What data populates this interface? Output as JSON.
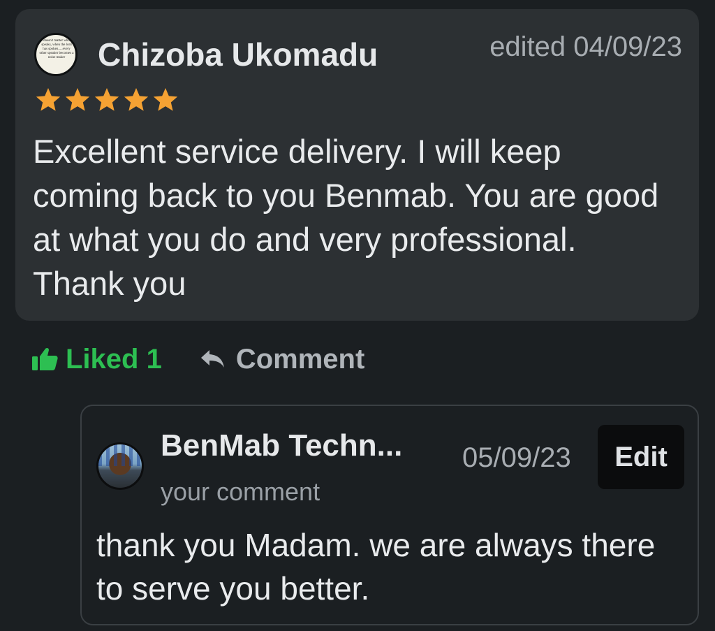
{
  "review": {
    "reviewer_name": "Chizoba Ukomadu",
    "date": "edited 04/09/23",
    "rating": 5,
    "rating_max": 5,
    "star_color": "#f5a233",
    "avatar_text": "doesn't matter who speaks, when the lord has spoken.....every other speaker becomes a noise maker",
    "text": "Excellent service delivery. I will keep coming back to you Benmab. You are good at what you do and very professional. Thank you"
  },
  "actions": {
    "like_label": "Liked 1",
    "like_icon": "thumbs-up-icon",
    "like_color": "#2dbf52",
    "comment_label": "Comment",
    "comment_icon": "reply-arrow-icon"
  },
  "reply": {
    "author_name": "BenMab Techn...",
    "date": "05/09/23",
    "edit_label": "Edit",
    "subtitle": "your comment",
    "text": "thank you Madam. we are always there to serve you better."
  }
}
